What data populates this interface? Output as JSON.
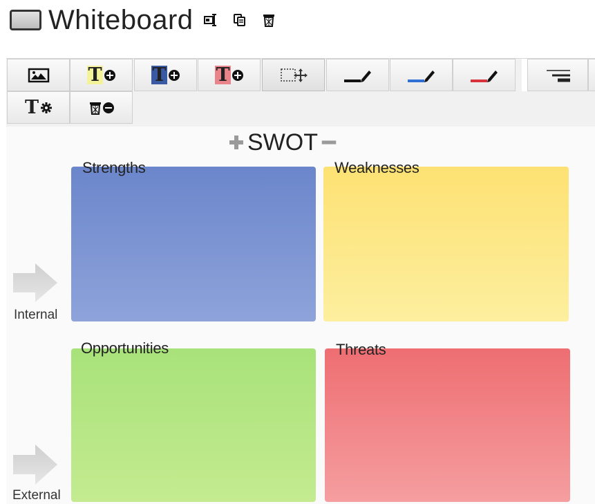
{
  "header": {
    "title": "Whiteboard",
    "actions": [
      {
        "name": "rename",
        "icon": "rename-icon"
      },
      {
        "name": "copy",
        "icon": "copy-icon"
      },
      {
        "name": "delete",
        "icon": "trash-icon"
      }
    ]
  },
  "toolbar": {
    "buttons": [
      {
        "name": "insert-image",
        "icon": "image-icon"
      },
      {
        "name": "add-yellow-text",
        "icon": "text-add-icon",
        "glyph": "T",
        "color": "#f4f39a"
      },
      {
        "name": "add-blue-text",
        "icon": "text-add-icon",
        "glyph": "T",
        "color": "#3a5ba4"
      },
      {
        "name": "add-red-text",
        "icon": "text-add-icon",
        "glyph": "T",
        "color": "#e8848a"
      },
      {
        "name": "select-move",
        "icon": "select-move-icon",
        "active": true
      },
      {
        "name": "pen-black",
        "icon": "pen-icon",
        "color": "#111111"
      },
      {
        "name": "pen-blue",
        "icon": "pen-icon",
        "color": "#2f6fd6"
      },
      {
        "name": "pen-red",
        "icon": "pen-icon",
        "color": "#d8323c"
      },
      {
        "name": "line-width",
        "icon": "line-width-icon"
      },
      {
        "name": "text-settings",
        "icon": "text-settings-icon",
        "glyph": "T"
      },
      {
        "name": "remove-items",
        "icon": "trash-remove-icon"
      }
    ]
  },
  "board": {
    "title": "SWOT",
    "quadrants": {
      "strengths": {
        "label": "Strengths",
        "color": "#7b93d3"
      },
      "weaknesses": {
        "label": "Weaknesses",
        "color": "#fde886"
      },
      "opportunities": {
        "label": "Opportunities",
        "color": "#b6e686"
      },
      "threats": {
        "label": "Threats",
        "color": "#f08a8d"
      }
    },
    "rows": [
      {
        "label": "Internal"
      },
      {
        "label": "External"
      }
    ]
  }
}
